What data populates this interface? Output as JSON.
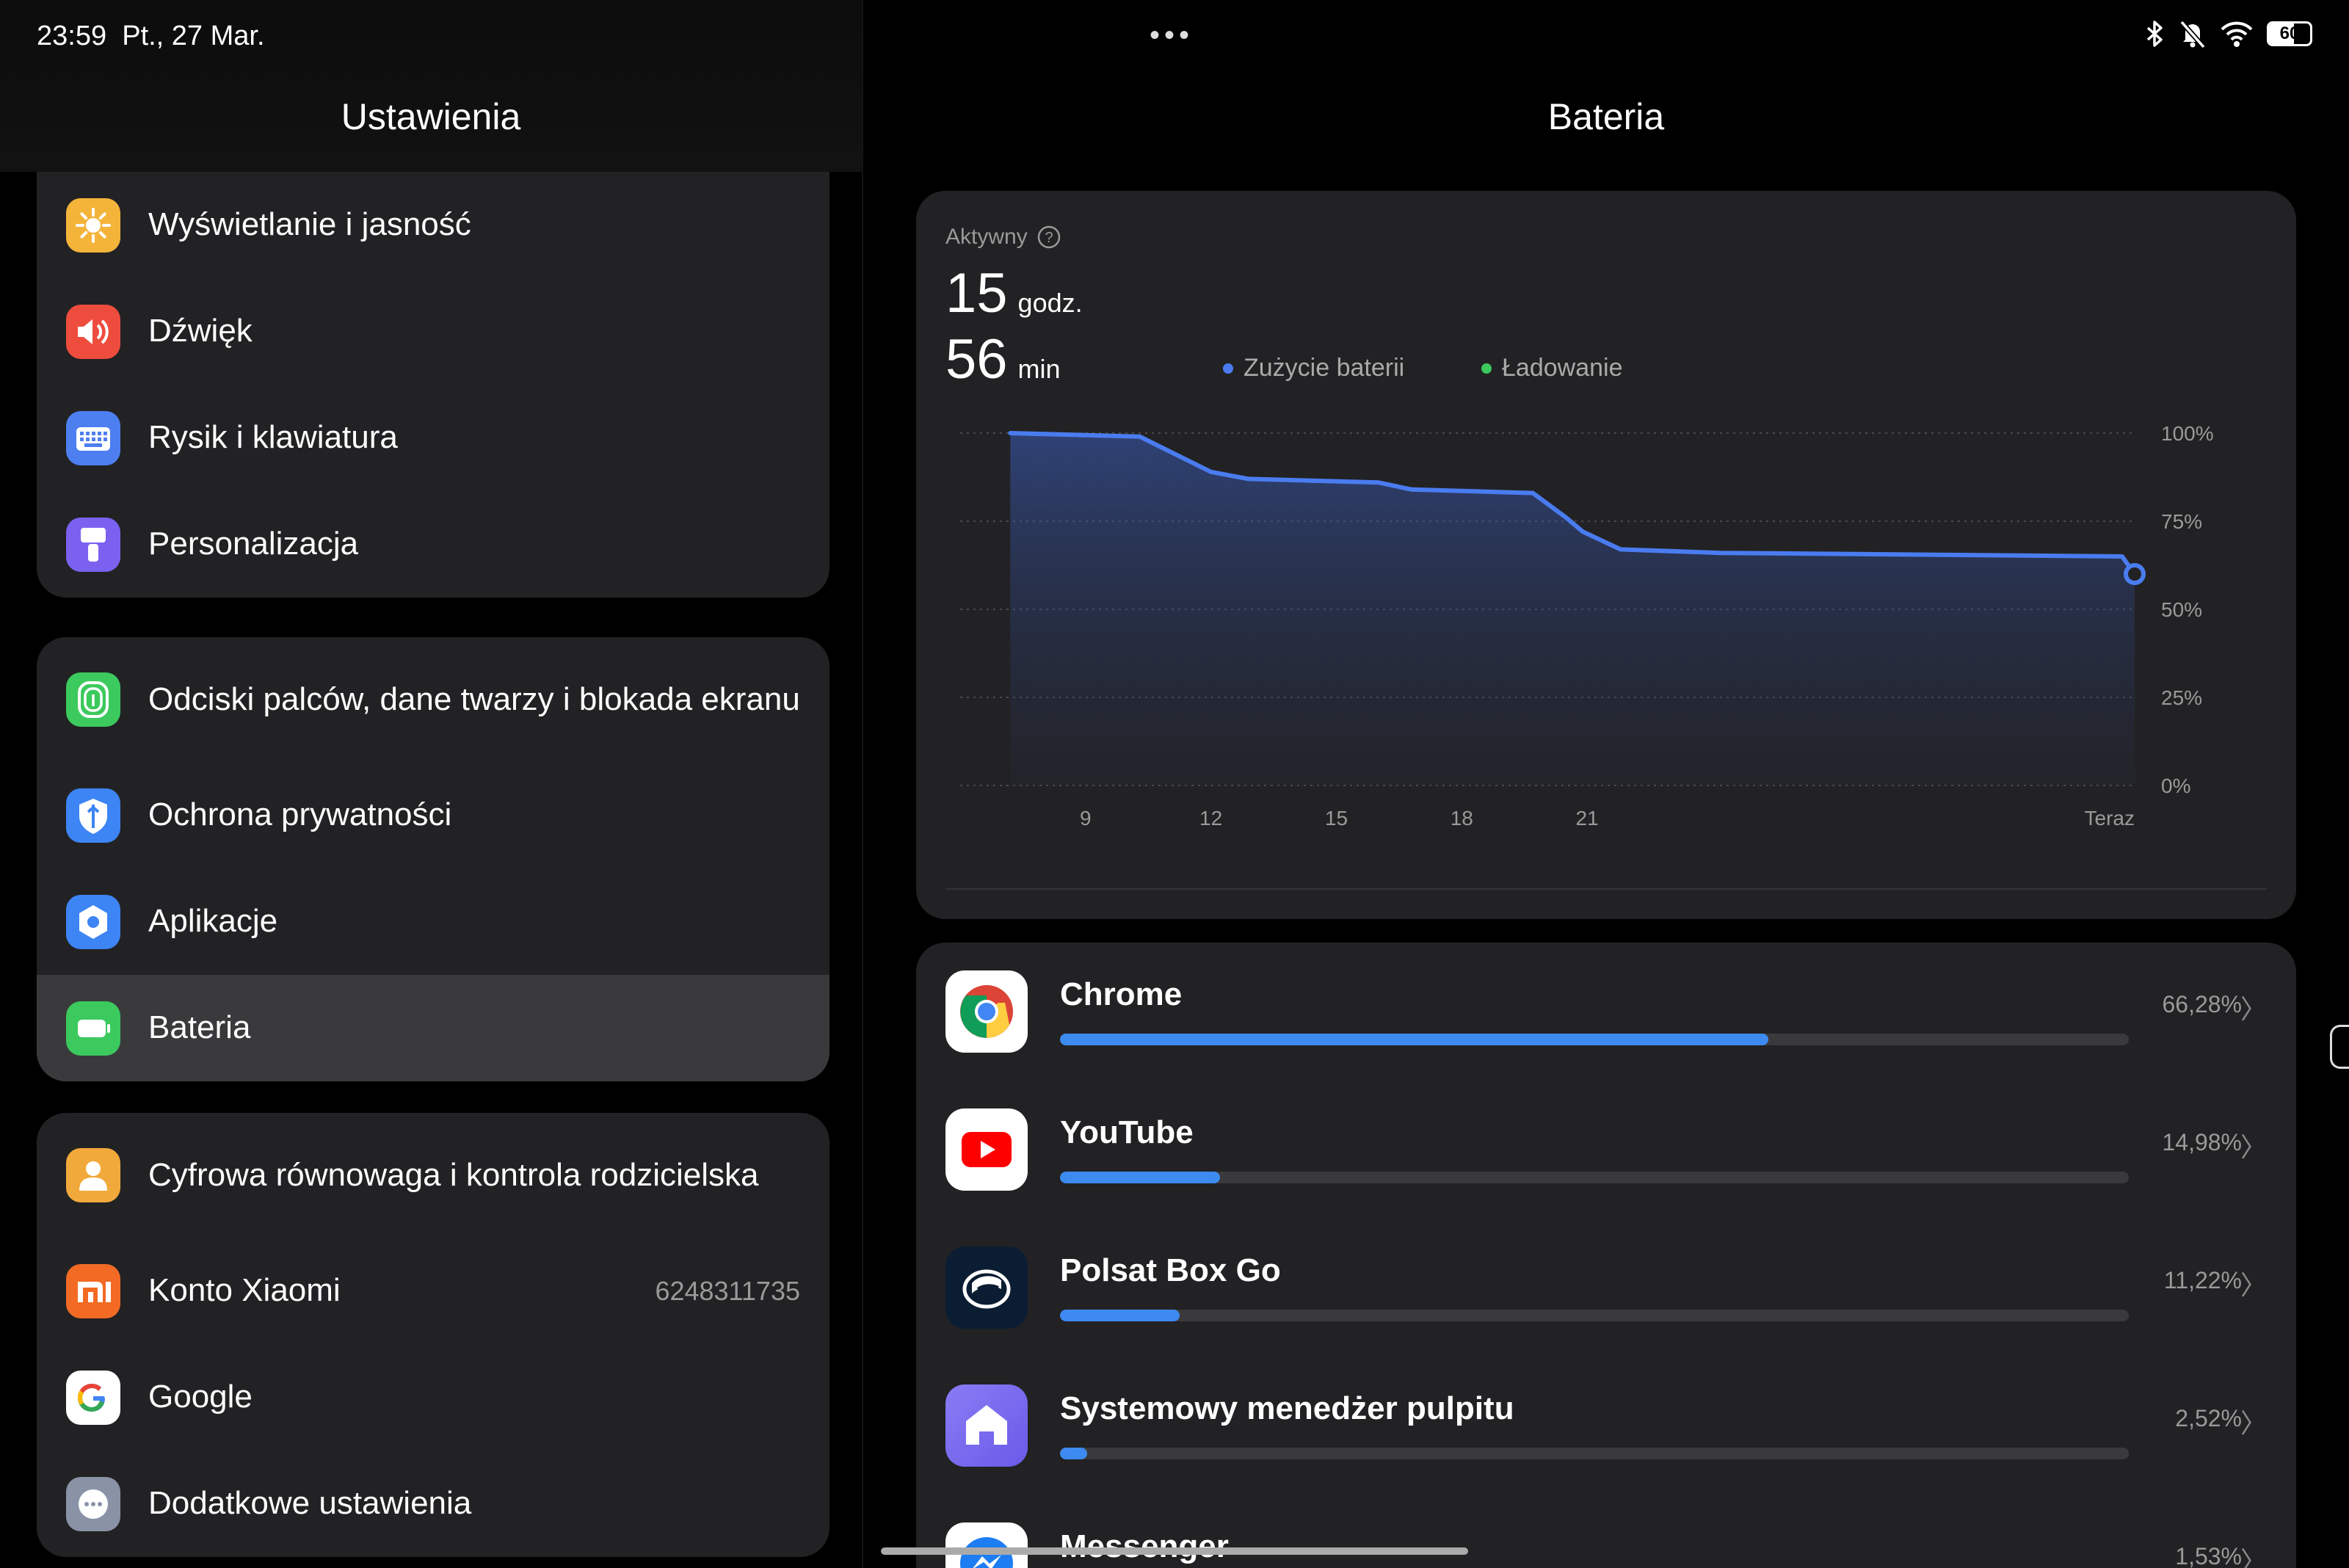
{
  "status": {
    "time": "23:59",
    "date": "Pt., 27 Mar.",
    "battery": "60",
    "battery_level": 0.6
  },
  "left": {
    "title": "Ustawienia",
    "groups": [
      [
        {
          "label": "Wyświetlanie i jasność",
          "icon": "sun-icon",
          "color": "#f4b43a"
        },
        {
          "label": "Dźwięk",
          "icon": "speaker-icon",
          "color": "#ee4d3e"
        },
        {
          "label": "Rysik i klawiatura",
          "icon": "keyboard-icon",
          "color": "#4d7ff0"
        },
        {
          "label": "Personalizacja",
          "icon": "brush-icon",
          "color": "#7b61f0"
        }
      ],
      [
        {
          "label": "Odciski palców, dane twarzy i blokada ekranu",
          "icon": "fingerprint-icon",
          "color": "#3cc95e"
        },
        {
          "label": "Ochrona prywatności",
          "icon": "shield-icon",
          "color": "#3d84f5"
        },
        {
          "label": "Aplikacje",
          "icon": "gear-icon",
          "color": "#3d84f5"
        },
        {
          "label": "Bateria",
          "icon": "battery-icon",
          "color": "#3cc95e"
        }
      ],
      [
        {
          "label": "Cyfrowa równowaga i kontrola rodzicielska",
          "icon": "person-icon",
          "color": "#f2a93b"
        },
        {
          "label": "Konto Xiaomi",
          "icon": "mi-icon",
          "color": "#f26a24",
          "value": "6248311735"
        },
        {
          "label": "Google",
          "icon": "google-icon",
          "color": "#ffffff"
        },
        {
          "label": "Dodatkowe ustawienia",
          "icon": "more-icon",
          "color": "#8a93a6"
        }
      ]
    ]
  },
  "right": {
    "title": "Bateria",
    "active_label": "Aktywny",
    "hours": "15",
    "hours_unit": "godz.",
    "minutes": "56",
    "minutes_unit": "min",
    "legend_usage": "Zużycie baterii",
    "legend_charging": "Ładowanie",
    "colors": {
      "usage": "#4a7cf0",
      "charging": "#3cc95e",
      "bar": "#3d8bf0"
    },
    "apps": [
      {
        "name": "Chrome",
        "pct": "66,28%",
        "value": 66.28,
        "icon": "chrome-icon"
      },
      {
        "name": "YouTube",
        "pct": "14,98%",
        "value": 14.98,
        "icon": "youtube-icon"
      },
      {
        "name": "Polsat Box Go",
        "pct": "11,22%",
        "value": 11.22,
        "icon": "polsat-icon"
      },
      {
        "name": "Systemowy menedżer pulpitu",
        "pct": "2,52%",
        "value": 2.52,
        "icon": "home-icon"
      },
      {
        "name": "Messenger",
        "pct": "1,53%",
        "value": 1.53,
        "icon": "messenger-icon"
      }
    ]
  },
  "chart_data": {
    "type": "area",
    "x": [
      7.2,
      10.3,
      12.0,
      12.9,
      16.0,
      16.8,
      19.7,
      20.5,
      20.9,
      21.8,
      24.2,
      33.8,
      34.1
    ],
    "values": [
      100,
      99,
      89,
      87,
      86,
      84,
      83,
      76,
      72,
      67,
      66,
      65,
      60
    ],
    "xticks": [
      9,
      12,
      15,
      18,
      21
    ],
    "xtick_labels": [
      "9",
      "12",
      "15",
      "18",
      "21",
      "Teraz"
    ],
    "yticks": [
      "100%",
      "75%",
      "50%",
      "25%",
      "0%"
    ],
    "ylim": [
      0,
      100
    ],
    "grid": true,
    "series_name": "Zużycie baterii"
  }
}
